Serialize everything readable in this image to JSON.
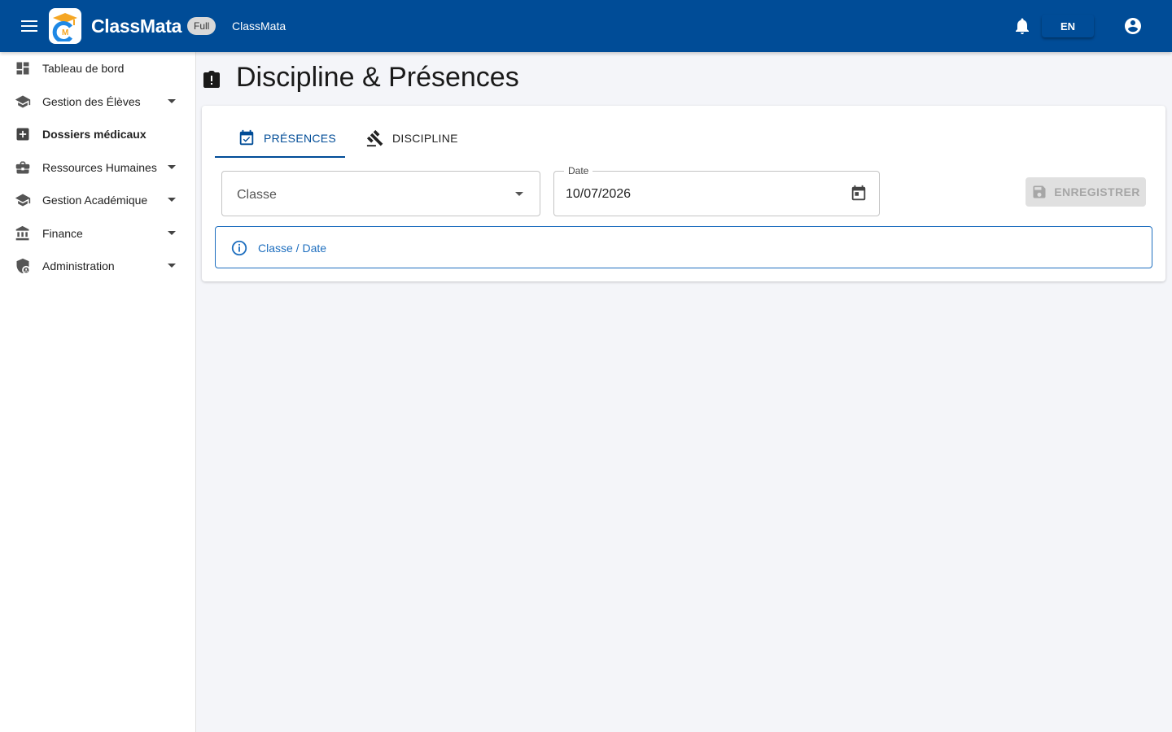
{
  "header": {
    "brand": "ClassMata",
    "plan_badge": "Full",
    "app_name": "ClassMata",
    "language": "EN",
    "colors": {
      "primary": "#004c97",
      "logo_orange": "#f5a623"
    }
  },
  "sidebar": {
    "items": [
      {
        "label": "Tableau de bord",
        "icon": "dashboard-icon",
        "has_submenu": false,
        "active": false
      },
      {
        "label": "Gestion des Élèves",
        "icon": "school-icon",
        "has_submenu": true,
        "active": false
      },
      {
        "label": "Dossiers médicaux",
        "icon": "medical-icon",
        "has_submenu": false,
        "active": true
      },
      {
        "label": "Ressources Humaines",
        "icon": "briefcase-icon",
        "has_submenu": true,
        "active": false
      },
      {
        "label": "Gestion Académique",
        "icon": "school-icon",
        "has_submenu": true,
        "active": false
      },
      {
        "label": "Finance",
        "icon": "bank-icon",
        "has_submenu": true,
        "active": false
      },
      {
        "label": "Administration",
        "icon": "admin-shield-icon",
        "has_submenu": true,
        "active": false
      }
    ]
  },
  "page": {
    "title": "Discipline & Présences"
  },
  "tabs": [
    {
      "label": "PRÉSENCES",
      "icon": "calendar-check-icon",
      "active": true
    },
    {
      "label": "DISCIPLINE",
      "icon": "gavel-icon",
      "active": false
    }
  ],
  "form": {
    "class_placeholder": "Classe",
    "date_label": "Date",
    "date_value": "10/07/2026",
    "save_label": "ENREGISTRER"
  },
  "alert": {
    "text": "Classe / Date"
  }
}
